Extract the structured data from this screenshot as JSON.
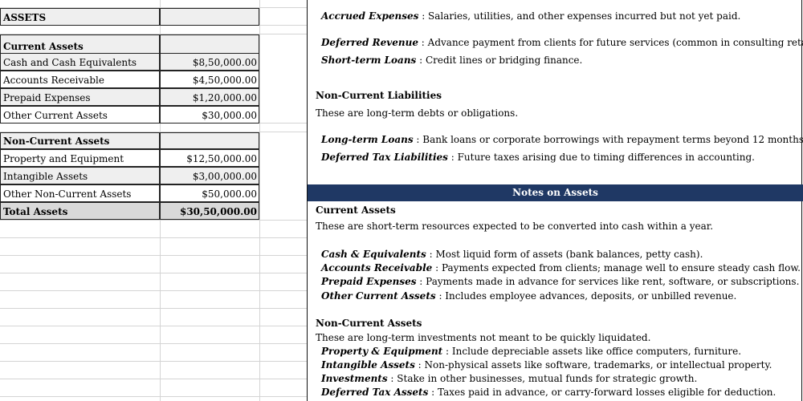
{
  "assets_table": {
    "header": "ASSETS",
    "current_heading": "Current Assets",
    "current_rows": [
      {
        "label": "Cash and Cash Equivalents",
        "value": "$8,50,000.00"
      },
      {
        "label": "Accounts Receivable",
        "value": "$4,50,000.00"
      },
      {
        "label": "Prepaid Expenses",
        "value": "$1,20,000.00"
      },
      {
        "label": "Other Current Assets",
        "value": "$30,000.00"
      }
    ],
    "noncurrent_heading": "Non-Current Assets",
    "noncurrent_rows": [
      {
        "label": "Property and Equipment",
        "value": "$12,50,000.00"
      },
      {
        "label": "Intangible Assets",
        "value": "$3,00,000.00"
      },
      {
        "label": "Other Non-Current Assets",
        "value": "$50,000.00"
      }
    ],
    "total_label": "Total Assets",
    "total_value": "$30,50,000.00"
  },
  "liabilities_notes": {
    "items_top": [
      {
        "term": "Accrued Expenses",
        "desc": " : Salaries, utilities, and other expenses incurred but not yet paid."
      },
      {
        "term": "Deferred Revenue",
        "desc": " : Advance payment from clients for future services (common in consulting retainers)."
      },
      {
        "term": "Short-term Loans",
        "desc": " : Credit lines or bridging finance."
      }
    ],
    "noncurrent_heading": "Non-Current Liabilities",
    "noncurrent_desc": "These are long-term debts or obligations.",
    "noncurrent_items": [
      {
        "term": "Long-term Loans",
        "desc": " : Bank loans or corporate borrowings with repayment terms beyond 12 months."
      },
      {
        "term": "Deferred Tax Liabilities",
        "desc": " : Future taxes arising due to timing differences in accounting."
      }
    ]
  },
  "notes_on_assets": {
    "banner": "Notes on Assets",
    "current_heading": "Current Assets",
    "current_desc": "These are short-term resources expected to be converted into cash within a year.",
    "current_items": [
      {
        "term": "Cash & Equivalents",
        "desc": " : Most liquid form of assets (bank balances, petty cash)."
      },
      {
        "term": "Accounts Receivable",
        "desc": " : Payments expected from clients; manage well to ensure steady cash flow."
      },
      {
        "term": "Prepaid Expenses",
        "desc": " : Payments made in advance for services like rent, software, or subscriptions."
      },
      {
        "term": "Other Current Assets",
        "desc": " : Includes employee advances, deposits, or unbilled revenue."
      }
    ],
    "noncurrent_heading": "Non-Current Assets",
    "noncurrent_desc": "These are long-term investments not meant to be quickly liquidated.",
    "noncurrent_items": [
      {
        "term": "Property & Equipment",
        "desc": " : Include depreciable assets like office computers, furniture."
      },
      {
        "term": "Intangible Assets",
        "desc": " : Non-physical assets like software, trademarks, or intellectual property."
      },
      {
        "term": "Investments",
        "desc": " : Stake in other businesses, mutual funds for strategic growth."
      },
      {
        "term": "Deferred Tax Assets",
        "desc": " : Taxes paid in advance, or carry-forward losses eligible for deduction."
      }
    ]
  }
}
